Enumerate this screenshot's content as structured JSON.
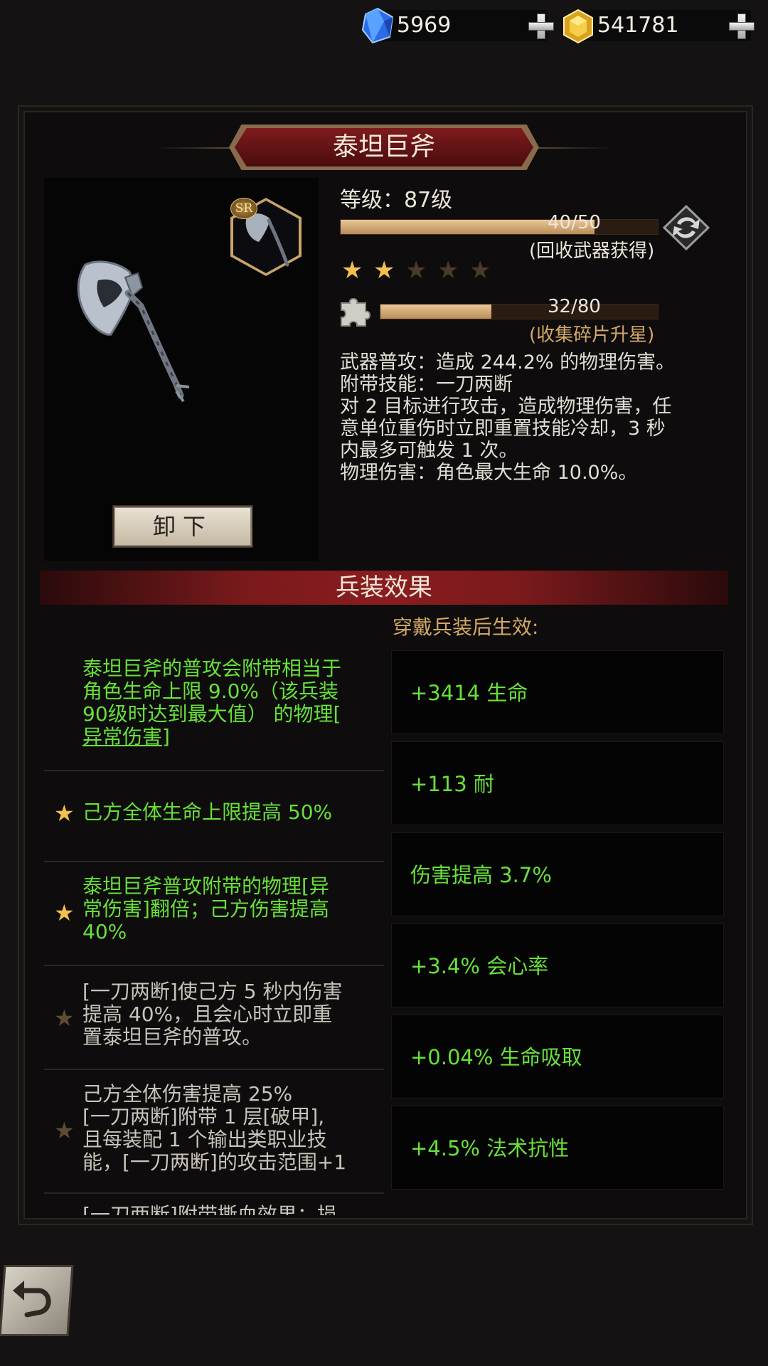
{
  "currency": {
    "gems": "5969",
    "gold": "541781",
    "gem_icon": "blue-crystal-icon",
    "gold_icon": "gold-crystal-icon"
  },
  "weapon": {
    "name": "泰坦巨斧",
    "rarity": "SR",
    "level": "等级：87级",
    "recycle_progress": "40/50",
    "recycle_fraction": 0.8,
    "recycle_note": "(回收武器获得)",
    "stars_filled": 2,
    "stars_total": 5,
    "shard_progress": "32/80",
    "shard_fraction": 0.4,
    "shard_note": "(收集碎片升星)",
    "unequip_label": "卸下",
    "description": [
      "武器普攻：造成 244.2% 的物理伤害。",
      "附带技能：一刀两断",
      "对 2 目标进行攻击，造成物理伤害，任",
      "意单位重伤时立即重置技能冷却，3 秒",
      "内最多可触发 1 次。",
      "物理伤害：角色最大生命 10.0%。"
    ]
  },
  "effects": {
    "title": "兵装效果",
    "after_equip_label": "穿戴兵装后生效:",
    "items": [
      {
        "lines": [
          "泰坦巨斧的普攻会附带相当于",
          "角色生命上限 9.0%（该兵装",
          "90级时达到最大值） 的物理[",
          "异常伤害]"
        ],
        "active": true,
        "star": false
      },
      {
        "lines": [
          "己方全体生命上限提高 50%"
        ],
        "active": true,
        "star": true
      },
      {
        "lines": [
          "泰坦巨斧普攻附带的物理[异",
          "常伤害]翻倍；己方伤害提高",
          "40%"
        ],
        "active": true,
        "star": true
      },
      {
        "lines": [
          "[一刀两断]使己方 5 秒内伤害",
          "提高 40%，且会心时立即重",
          "置泰坦巨斧的普攻。"
        ],
        "active": false,
        "star": true
      },
      {
        "lines": [
          "己方全体伤害提高 25%",
          "[一刀两断]附带 1 层[破甲],",
          "且每装配 1 个输出类职业技",
          "能，[一刀两断]的攻击范围+1"
        ],
        "active": false,
        "star": true
      },
      {
        "lines": [
          "[一刀两断]附带撕血效果：损"
        ],
        "active": false,
        "star": false
      }
    ],
    "bonuses": [
      "+3414 生命",
      "+113 耐",
      "伤害提高 3.7%",
      "+3.4% 会心率",
      "+0.04% 生命吸取",
      "+4.5% 法术抗性"
    ]
  },
  "colors": {
    "active_green": "#66e13a",
    "gold_text": "#d4a867",
    "banner_red": "#7a1a1c"
  }
}
